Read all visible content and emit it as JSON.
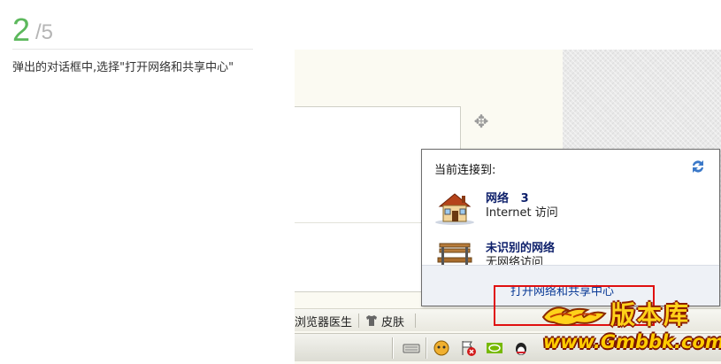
{
  "step": {
    "current": "2",
    "total": "/5",
    "description": "弹出的对话框中,选择\"打开网络和共享中心\""
  },
  "toolbar": {
    "browser_doctor": "浏览器医生",
    "skin": "皮肤"
  },
  "popup": {
    "title": "当前连接到:",
    "networks": [
      {
        "name": "网络   3",
        "status": "Internet 访问",
        "icon": "house-icon"
      },
      {
        "name": "未识别的网络",
        "status": "无网络访问",
        "icon": "bench-icon"
      }
    ],
    "footer_link": "打开网络和共享中心"
  },
  "watermark": {
    "brand": "版本库",
    "url": "www.Gmbbk.com"
  },
  "colors": {
    "step_green": "#5cb85c",
    "highlight_red": "#e01010",
    "network_name": "#0d1f6a"
  }
}
